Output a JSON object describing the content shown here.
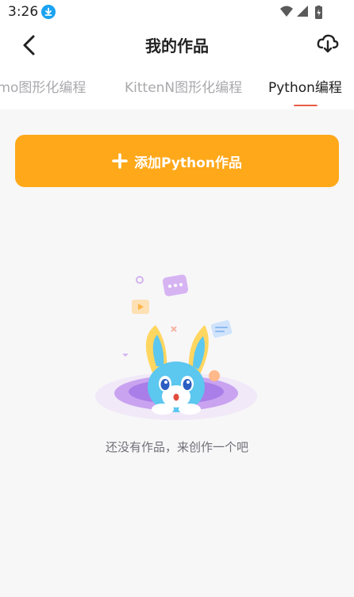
{
  "status_bar": {
    "time": "3:26"
  },
  "header": {
    "title": "我的作品"
  },
  "tabs": [
    {
      "label": "emo图形化编程"
    },
    {
      "label": "KittenN图形化编程"
    },
    {
      "label": "Python编程",
      "selected": true
    }
  ],
  "add_button": {
    "label": "添加Python作品"
  },
  "empty_state": {
    "message": "还没有作品，来创作一个吧"
  },
  "colors": {
    "accent": "#ffa81a",
    "tab_indicator": "#e85c44",
    "download_badge": "#1aa3f1"
  },
  "icons": {
    "back": "chevron-left-icon",
    "cloud": "cloud-download-icon",
    "plus": "plus-icon",
    "download": "download-icon",
    "wifi": "wifi-icon",
    "signal": "signal-icon",
    "battery": "battery-icon"
  }
}
